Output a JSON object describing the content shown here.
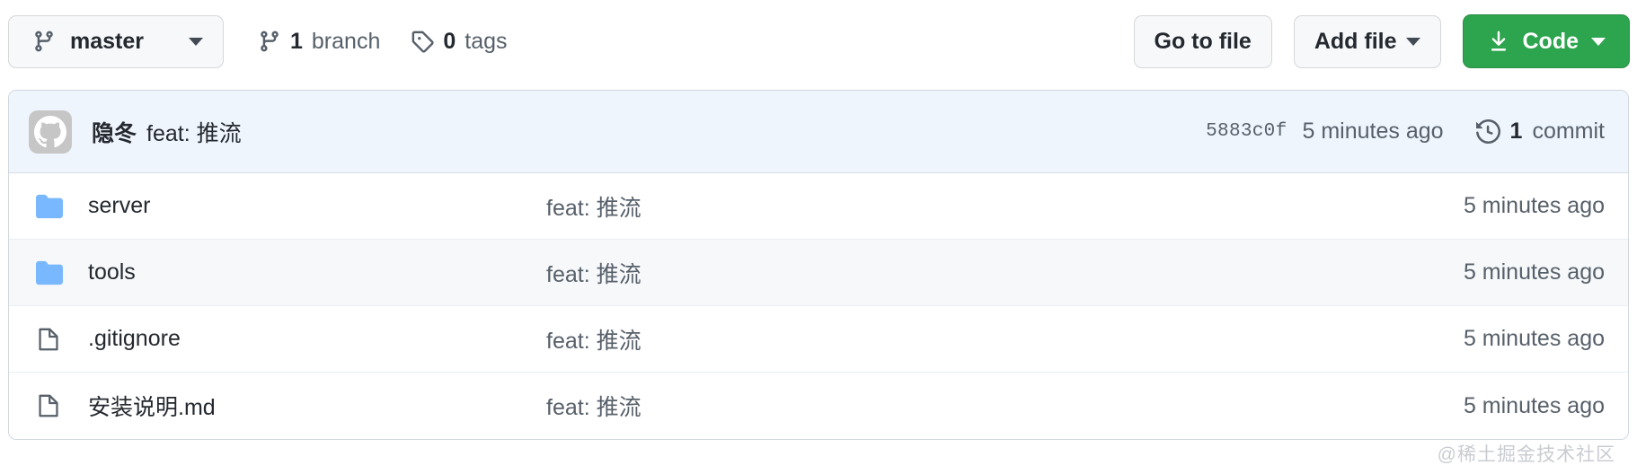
{
  "toolbar": {
    "branch_button": {
      "label": "master",
      "icon": "git-branch-icon"
    },
    "branches": {
      "count": "1",
      "label": "branch",
      "icon": "git-branch-icon"
    },
    "tags": {
      "count": "0",
      "label": "tags",
      "icon": "tag-icon"
    },
    "go_to_file": "Go to file",
    "add_file": "Add file",
    "code": "Code",
    "code_icon": "download-icon",
    "accent_color": "#2da44e"
  },
  "commit_bar": {
    "avatar_icon": "github-octocat-avatar",
    "author": "隐冬",
    "message": "feat: 推流",
    "sha": "5883c0f",
    "time": "5 minutes ago",
    "commit_count_number": "1",
    "commit_count_label": "commit",
    "history_icon": "history-clock-icon",
    "background_color": "#eff5fc"
  },
  "files": {
    "rows": [
      {
        "icon": "folder-icon",
        "type": "folder",
        "name": "server",
        "message": "feat: 推流",
        "time": "5 minutes ago"
      },
      {
        "icon": "folder-icon",
        "type": "folder",
        "name": "tools",
        "message": "feat: 推流",
        "time": "5 minutes ago"
      },
      {
        "icon": "file-icon",
        "type": "file",
        "name": ".gitignore",
        "message": "feat: 推流",
        "time": "5 minutes ago"
      },
      {
        "icon": "file-icon",
        "type": "file",
        "name": "安装说明.md",
        "message": "feat: 推流",
        "time": "5 minutes ago"
      }
    ],
    "folder_color": "#79b8ff",
    "file_icon_color": "#57606a"
  },
  "watermark": {
    "text": "@稀土掘金技术社区"
  }
}
